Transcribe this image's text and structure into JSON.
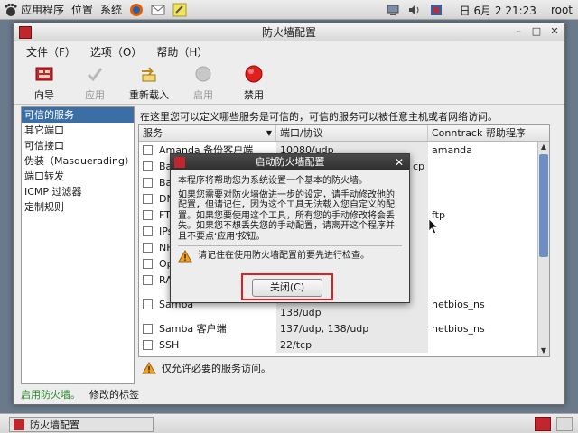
{
  "top_panel": {
    "applications": "应用程序",
    "places": "位置",
    "system": "系统",
    "clock": "日 6月  2 21:23",
    "user": "root"
  },
  "window": {
    "title": "防火墙配置",
    "menu": [
      "文件（F）",
      "选项（O）",
      "帮助（H）"
    ],
    "toolbar": {
      "wizard": "向导",
      "apply": "应用",
      "reload": "重新载入",
      "enable": "启用",
      "disable": "禁用"
    },
    "sidebar": [
      "可信的服务",
      "其它端口",
      "可信接口",
      "伪装（Masquerading）",
      "端口转发",
      "ICMP 过滤器",
      "定制规则"
    ],
    "description": "在这里您可以定义哪些服务是可信的，可信的服务可以被任意主机或者网络访问。",
    "table": {
      "headers": [
        "服务",
        "端口/协议",
        "Conntrack 帮助程序"
      ],
      "rows": [
        {
          "service": "Amanda 备份客户端",
          "port": "10080/udp",
          "helper": "amanda"
        },
        {
          "service": "Ba",
          "port": "",
          "helper": ""
        },
        {
          "service": "Ba",
          "port": "",
          "helper": ""
        },
        {
          "service": "DN",
          "port": "",
          "helper": ""
        },
        {
          "service": "FT",
          "port": "",
          "helper": "ftp"
        },
        {
          "service": "IPs",
          "port": "",
          "helper": ""
        },
        {
          "service": "NF",
          "port": "",
          "helper": ""
        },
        {
          "service": "Op",
          "port": "",
          "helper": ""
        },
        {
          "service": "RA",
          "port": "",
          "helper": ""
        },
        {
          "service": "Samba",
          "port": "138/udp",
          "helper": "netbios_ns"
        },
        {
          "service": "Samba 客户端",
          "port": "137/udp, 138/udp",
          "helper": "netbios_ns"
        },
        {
          "service": "SSH",
          "port": "22/tcp",
          "helper": ""
        }
      ],
      "partial_port_row1": "cp"
    },
    "hint": "仅允许必要的服务访问。",
    "status": {
      "enabled": "启用防火墙。",
      "modified": "修改的标签"
    }
  },
  "dialog": {
    "title": "启动防火墙配置",
    "line1": "本程序将帮助您为系统设置一个基本的防火墙。",
    "line2": "如果您需要对防火墙做进一步的设定，请手动修改他的配置，但请记住，因为这个工具无法载入您自定义的配置。如果您要使用这个工具，所有您的手动修改将会丢失。如果您不想丢失您的手动配置，请离开这个程序并且不要点‘应用’按钮。",
    "warning": "请记住在使用防火墙配置前要先进行检查。",
    "close_button": "关闭(C)"
  },
  "taskbar": {
    "task": "防火墙配置"
  },
  "colors": {
    "selection": "#3a6ea5",
    "highlight_box": "#e0201e",
    "status_ok": "#2e8b2e"
  }
}
